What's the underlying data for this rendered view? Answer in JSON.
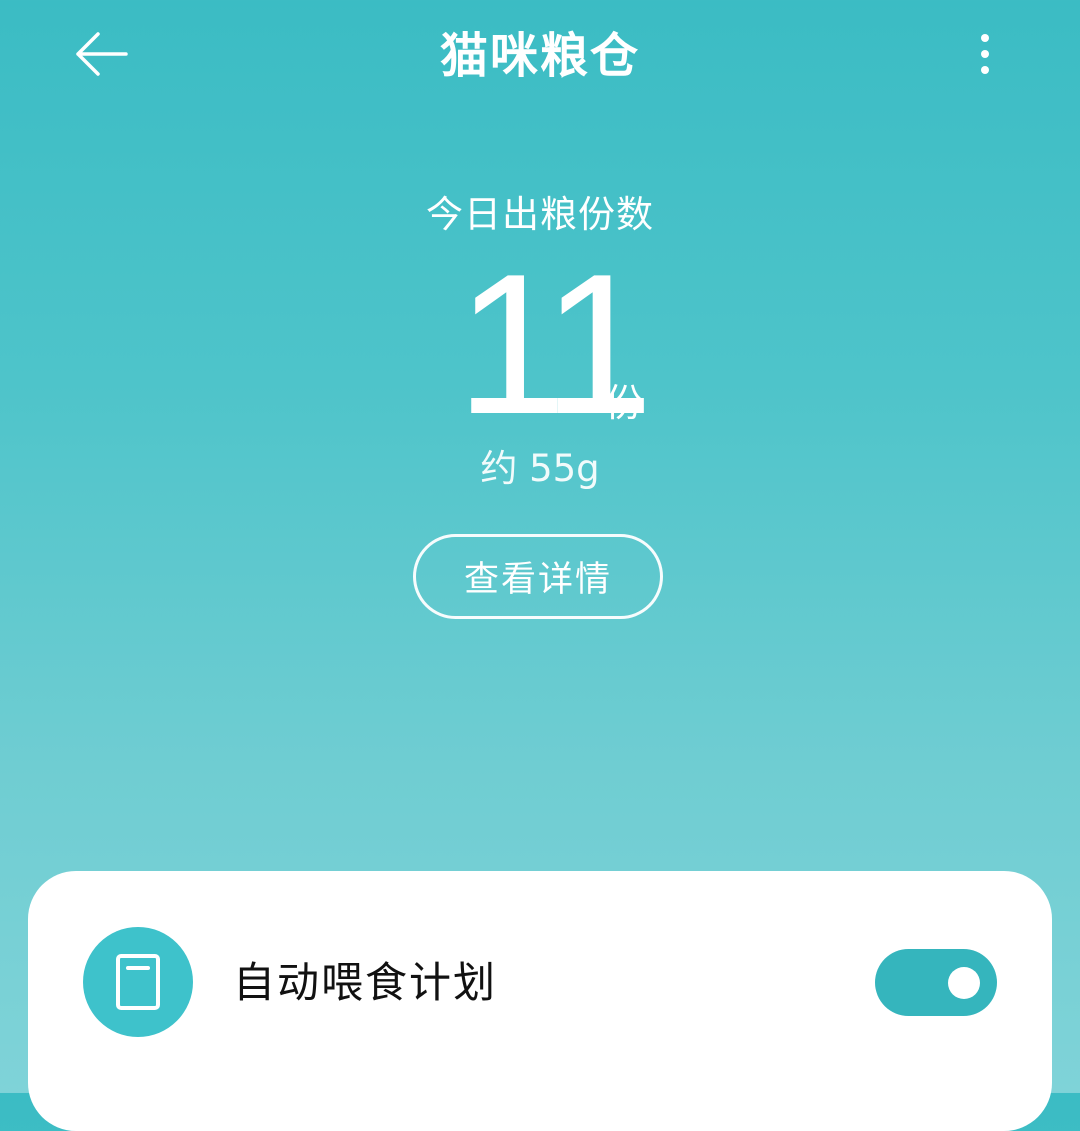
{
  "header": {
    "title": "猫咪粮仓",
    "back_icon": "arrow-left-icon",
    "more_icon": "more-vertical-icon"
  },
  "summary": {
    "label": "今日出粮份数",
    "count": "11",
    "unit": "份",
    "approx_weight": "约 55g",
    "detail_button": "查看详情"
  },
  "card": {
    "plan": {
      "icon": "book-icon",
      "label": "自动喂食计划",
      "enabled": true
    }
  },
  "colors": {
    "accent": "#3ec2cb",
    "toggle_on": "#35b5bd",
    "background_top": "#3bbcc4",
    "background_bottom": "#7fd3d8"
  }
}
